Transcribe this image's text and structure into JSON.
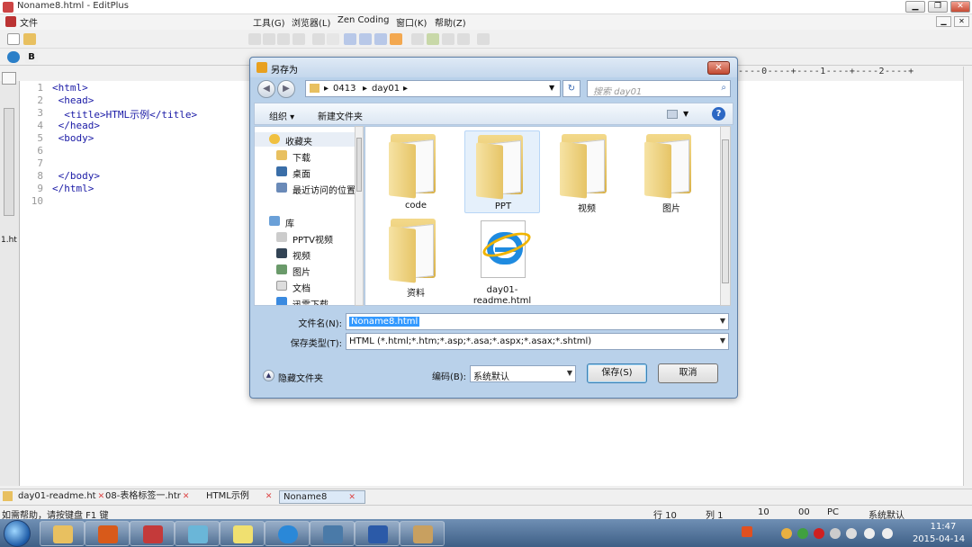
{
  "window": {
    "title": "Noname8.html - EditPlus",
    "menu": {
      "file": "文件",
      "tools": "工具(G)",
      "browser": "浏览器(L)",
      "zen": "Zen Coding",
      "window": "窗口(K)",
      "help": "帮助(Z)"
    },
    "controls": {
      "minimize": "▁",
      "restore": "❐",
      "close": "✕"
    }
  },
  "editor": {
    "ruler": "----0----+----1----+----2----+",
    "lines": [
      {
        "n": "1",
        "text": "<html>"
      },
      {
        "n": "2",
        "text": " <head>"
      },
      {
        "n": "3",
        "text": "  <title>HTML示例</title>"
      },
      {
        "n": "4",
        "text": " </head>"
      },
      {
        "n": "5",
        "text": " <body>"
      },
      {
        "n": "6",
        "text": ""
      },
      {
        "n": "7",
        "text": ""
      },
      {
        "n": "8",
        "text": " </body>"
      },
      {
        "n": "9",
        "text": "</html>"
      },
      {
        "n": "10",
        "text": ""
      }
    ],
    "side_label": "1.ht"
  },
  "tabs": [
    {
      "label": "day01-readme.ht",
      "active": false
    },
    {
      "label": "08-表格标签一.htr",
      "active": false
    },
    {
      "label": "HTML示例",
      "active": false
    },
    {
      "label": "Noname8",
      "active": true
    }
  ],
  "status": {
    "help": "如需帮助，请按键盘 F1 键",
    "row": "行 10",
    "col": "列 1",
    "a": "10",
    "b": "00",
    "mode": "PC",
    "encoding": "系统默认"
  },
  "taskbar": {
    "time": "11:47",
    "date": "2015-04-14"
  },
  "dialog": {
    "title": "另存为",
    "close": "✕",
    "breadcrumb": [
      "0413",
      "day01"
    ],
    "search_placeholder": "搜索 day01",
    "toolbar": {
      "organize": "组织 ▾",
      "new_folder": "新建文件夹",
      "help": "?"
    },
    "nav": {
      "favorites": "收藏夹",
      "fav_items": [
        "下载",
        "桌面",
        "最近访问的位置"
      ],
      "library": "库",
      "lib_items": [
        "PPTV视频",
        "视频",
        "图片",
        "文档",
        "迅雷下载"
      ]
    },
    "files": [
      {
        "name": "code",
        "kind": "folder"
      },
      {
        "name": "PPT",
        "kind": "folder"
      },
      {
        "name": "视频",
        "kind": "folder"
      },
      {
        "name": "图片",
        "kind": "folder"
      },
      {
        "name": "资料",
        "kind": "folder"
      },
      {
        "name": "day01-readme.html",
        "kind": "html"
      }
    ],
    "filename_label": "文件名(N):",
    "filename_value": "Noname8.html",
    "filetype_label": "保存类型(T):",
    "filetype_value": "HTML (*.html;*.htm;*.asp;*.asa;*.aspx;*.asax;*.shtml)",
    "encoding_label": "编码(B):",
    "encoding_value": "系统默认",
    "hide_folders": "隐藏文件夹",
    "save": "保存(S)",
    "cancel": "取消"
  },
  "colors": {
    "accent": "#3399ff",
    "dialog_frame": "#b9d1ea",
    "code": "#1a1aa6",
    "taskbar": "#3e5f86"
  }
}
